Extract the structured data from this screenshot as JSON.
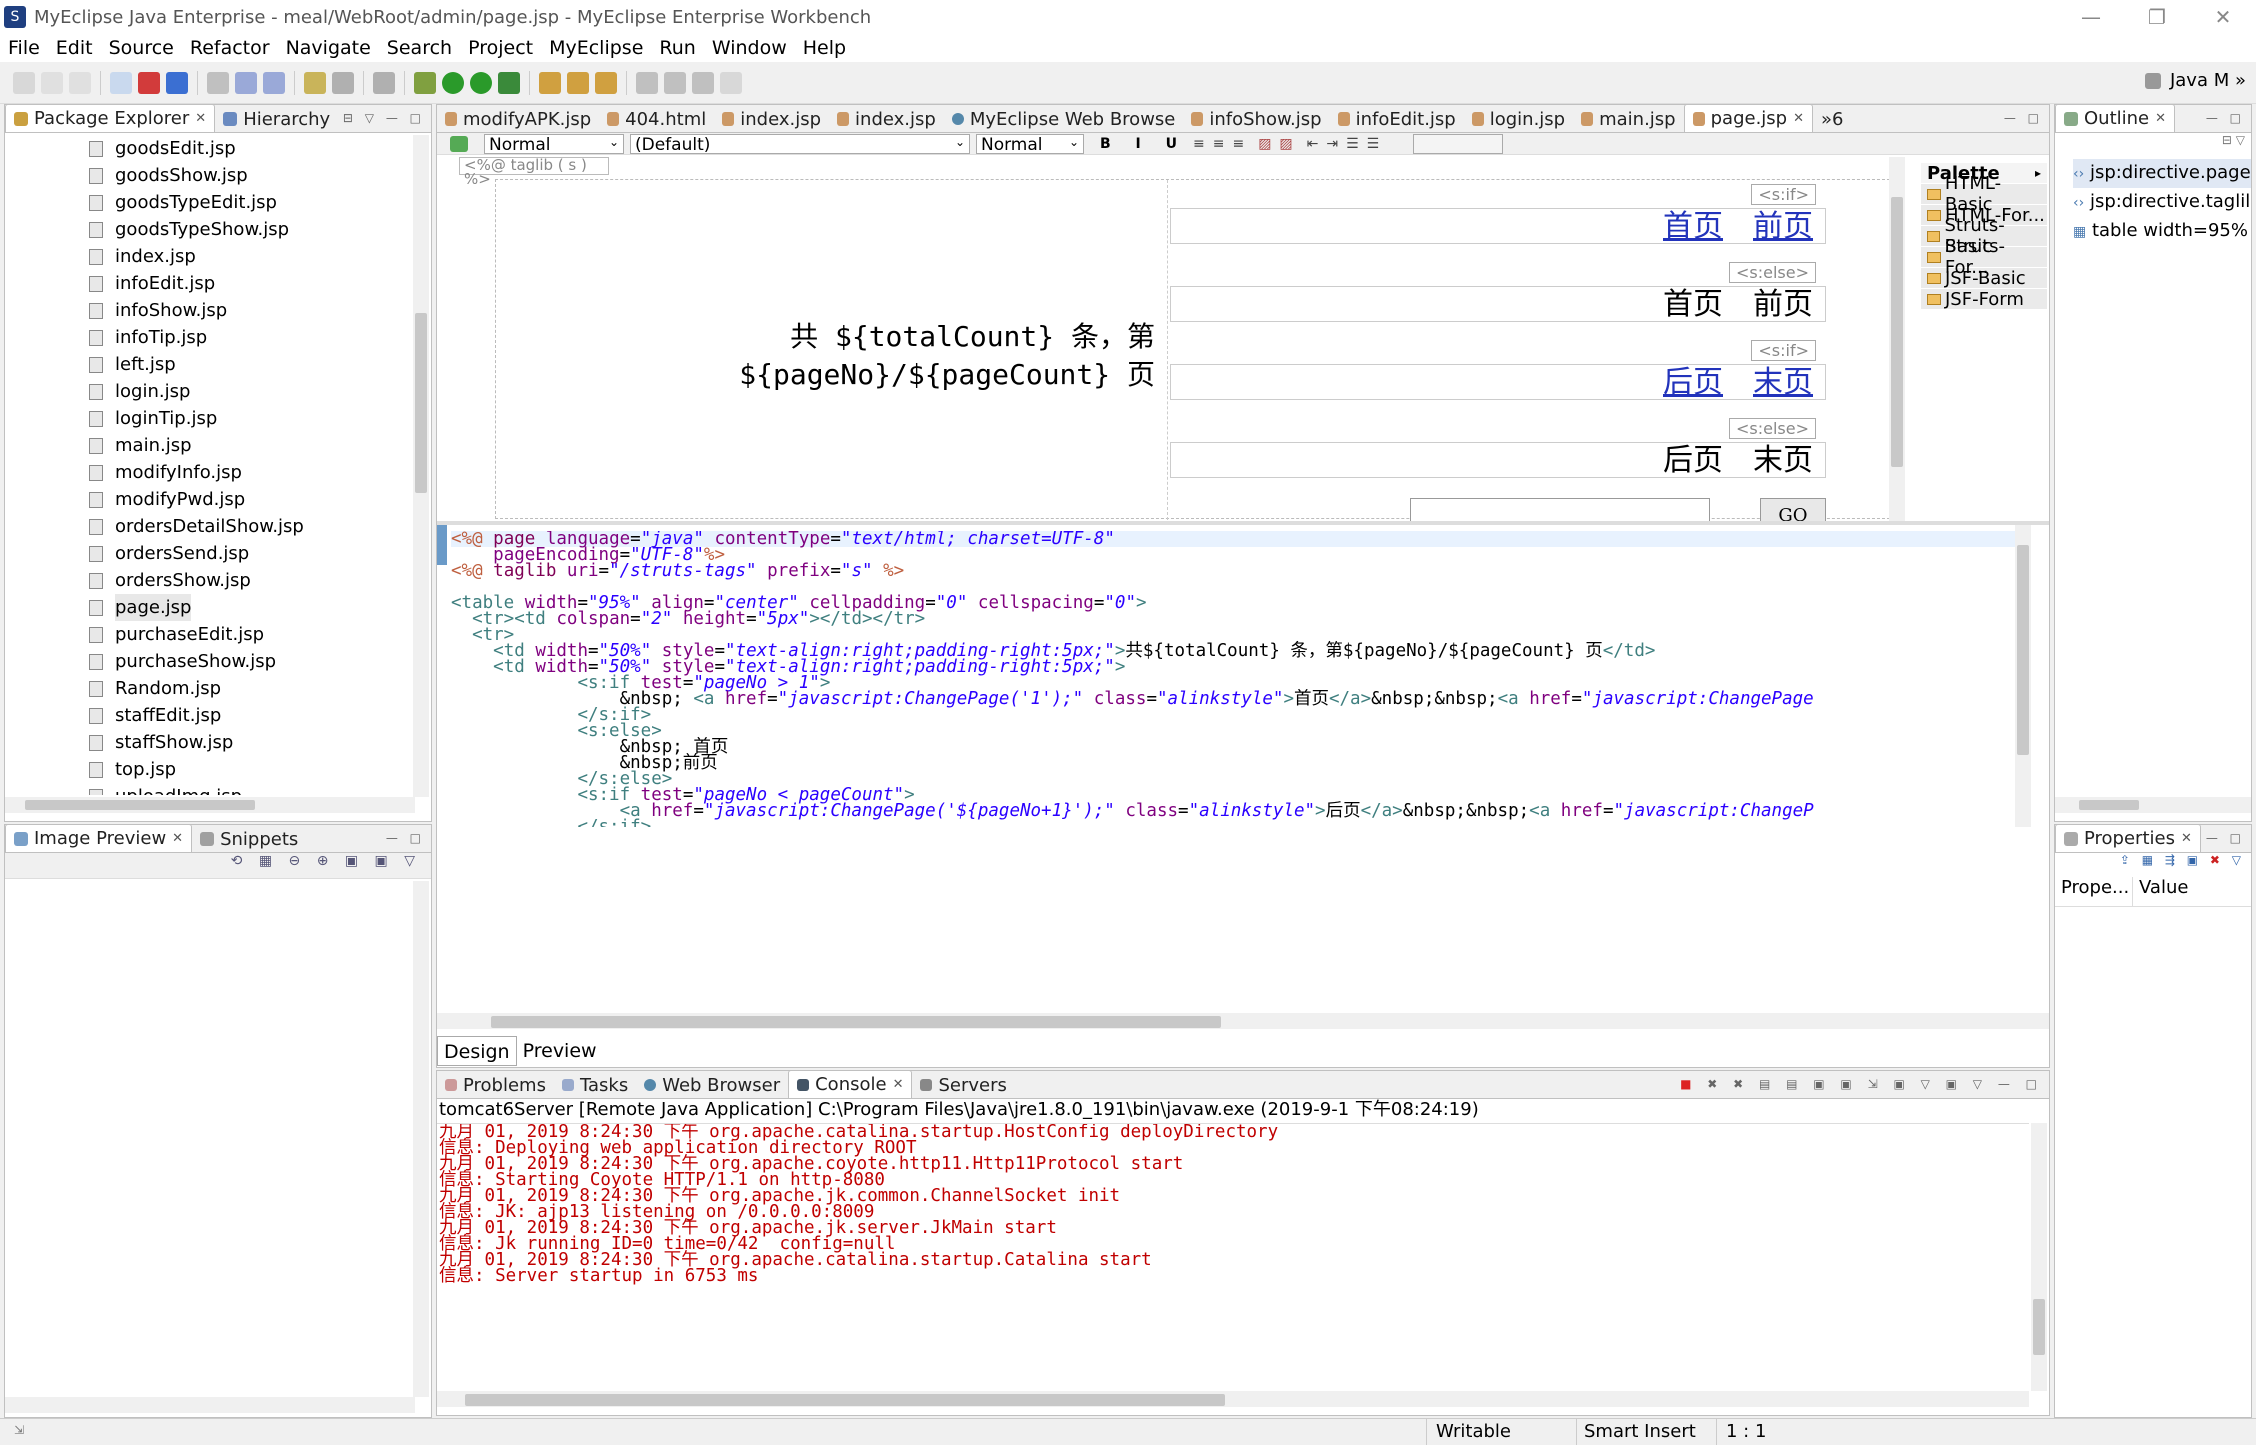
{
  "window": {
    "title": "MyEclipse Java Enterprise - meal/WebRoot/admin/page.jsp - MyEclipse Enterprise Workbench"
  },
  "menu": [
    "File",
    "Edit",
    "Source",
    "Refactor",
    "Navigate",
    "Search",
    "Project",
    "MyEclipse",
    "Run",
    "Window",
    "Help"
  ],
  "perspective": {
    "label": "Java",
    "extra": "M"
  },
  "package_explorer": {
    "tab1": "Package Explorer",
    "tab2": "Hierarchy",
    "items": [
      "goodsEdit.jsp",
      "goodsShow.jsp",
      "goodsTypeEdit.jsp",
      "goodsTypeShow.jsp",
      "index.jsp",
      "infoEdit.jsp",
      "infoShow.jsp",
      "infoTip.jsp",
      "left.jsp",
      "login.jsp",
      "loginTip.jsp",
      "main.jsp",
      "modifyInfo.jsp",
      "modifyPwd.jsp",
      "ordersDetailShow.jsp",
      "ordersSend.jsp",
      "ordersShow.jsp",
      "page.jsp",
      "purchaseEdit.jsp",
      "purchaseShow.jsp",
      "Random.jsp",
      "staffEdit.jsp",
      "staffShow.jsp",
      "top.jsp",
      "uploadImg.jsp"
    ],
    "selected": "page.jsp"
  },
  "image_preview": {
    "tab1": "Image Preview",
    "tab2": "Snippets"
  },
  "editor": {
    "tabs": [
      "modifyAPK.jsp",
      "404.html",
      "index.jsp",
      "index.jsp",
      "MyEclipse Web Browse",
      "infoShow.jsp",
      "infoEdit.jsp",
      "login.jsp",
      "main.jsp",
      "page.jsp"
    ],
    "active_tab": "page.jsp",
    "overflow": "»6",
    "format": {
      "style": "Normal",
      "font": "(Default)",
      "size": "Normal"
    },
    "design": {
      "taglib_tag": "<%@ taglib ( s ) %>",
      "left_line1": "共 ${totalCount} 条，第",
      "left_line2": "${pageNo}/${pageCount} 页",
      "sif1": "<s:if>",
      "first_link": "首页",
      "prev_link": "前页",
      "selse1": "<s:else>",
      "first_text": "首页",
      "prev_text": "前页",
      "sif2": "<s:if>",
      "next_link": "后页",
      "last_link": "末页",
      "selse2": "<s:else>",
      "next_text": "后页",
      "last_text": "末页",
      "go_button": "GO"
    },
    "palette": {
      "title": "Palette",
      "items": [
        "HTML-Basic",
        "HTML-For...",
        "Struts-Basic",
        "Struts-For...",
        "JSF-Basic",
        "JSF-Form"
      ]
    },
    "bottom_tabs": [
      "Design",
      "Preview"
    ]
  },
  "outline": {
    "title": "Outline",
    "items": [
      "jsp:directive.page",
      "jsp:directive.taglil",
      "table width=95%"
    ]
  },
  "properties": {
    "title": "Properties",
    "col1": "Prope...",
    "col2": "Value"
  },
  "console": {
    "tabs": [
      "Problems",
      "Tasks",
      "Web Browser",
      "Console",
      "Servers"
    ],
    "active_tab": "Console",
    "header": "tomcat6Server [Remote Java Application] C:\\Program Files\\Java\\jre1.8.0_191\\bin\\javaw.exe (2019-9-1 下午08:24:19)",
    "lines": [
      "九月 01, 2019 8:24:30 下午 org.apache.catalina.startup.HostConfig deployDirectory",
      "信息: Deploying web application directory ROOT",
      "九月 01, 2019 8:24:30 下午 org.apache.coyote.http11.Http11Protocol start",
      "信息: Starting Coyote HTTP/1.1 on http-8080",
      "九月 01, 2019 8:24:30 下午 org.apache.jk.common.ChannelSocket init",
      "信息: JK: ajp13 listening on /0.0.0.0:8009",
      "九月 01, 2019 8:24:30 下午 org.apache.jk.server.JkMain start",
      "信息: Jk running ID=0 time=0/42  config=null",
      "九月 01, 2019 8:24:30 下午 org.apache.catalina.startup.Catalina start",
      "信息: Server startup in 6753 ms"
    ]
  },
  "status": {
    "writable": "Writable",
    "insert": "Smart Insert",
    "position": "1 : 1"
  }
}
